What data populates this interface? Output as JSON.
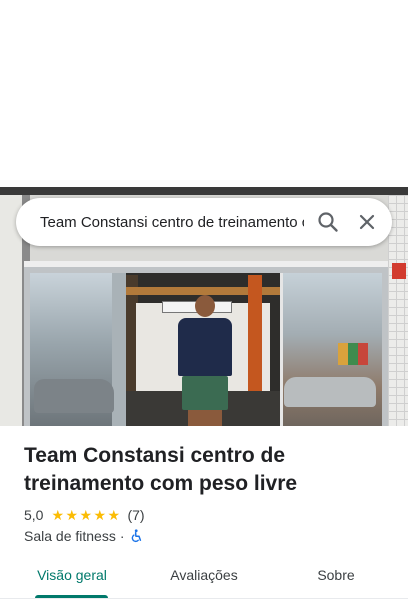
{
  "search": {
    "query": "Team Constansi centro de treinamento com peso livre"
  },
  "place": {
    "name": "Team Constansi centro de treinamento com peso livre",
    "rating": "5,0",
    "rating_stars": 5,
    "review_count": "(7)",
    "category": "Sala de fitness",
    "separator": "·",
    "accessibility_icon": "wheelchair-icon"
  },
  "tabs": [
    {
      "label": "Visão geral",
      "active": true
    },
    {
      "label": "Avaliações",
      "active": false
    },
    {
      "label": "Sobre",
      "active": false
    }
  ],
  "colors": {
    "accent": "#00796b",
    "star": "#fbbc04",
    "accessibility": "#1a73e8"
  }
}
